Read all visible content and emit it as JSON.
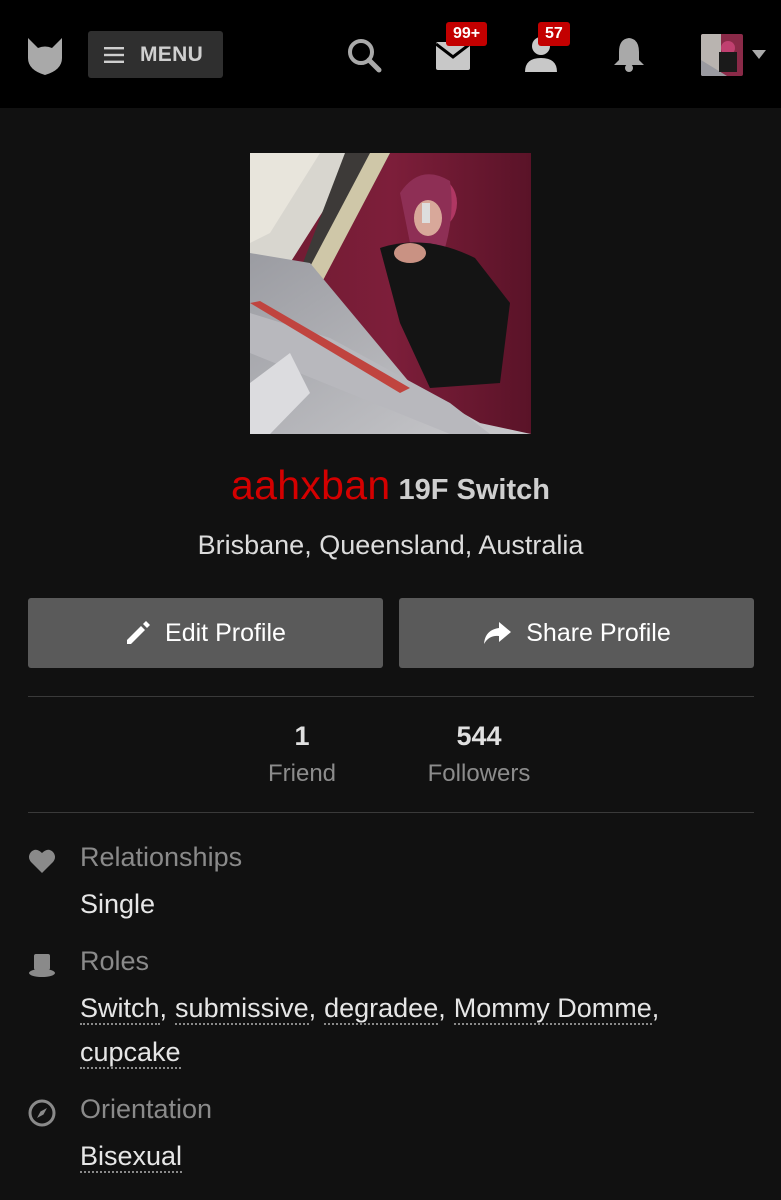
{
  "header": {
    "menu_label": "MENU",
    "mail_badge": "99+",
    "user_badge": "57",
    "icons": [
      "site-logo-icon",
      "search-icon",
      "mail-icon",
      "user-icon",
      "bell-icon",
      "chevron-down-icon"
    ]
  },
  "profile": {
    "username": "aahxban",
    "age_sex_role": "19F Switch",
    "location": "Brisbane, Queensland, Australia",
    "edit_label": "Edit Profile",
    "share_label": "Share Profile"
  },
  "stats": {
    "friends_count": "1",
    "friends_label": "Friend",
    "followers_count": "544",
    "followers_label": "Followers"
  },
  "details": {
    "relationships_title": "Relationships",
    "relationships_value": "Single",
    "roles_title": "Roles",
    "roles": [
      "Switch",
      "submissive",
      "degradee",
      "Mommy Domme",
      "cupcake"
    ],
    "orientation_title": "Orientation",
    "orientation_value": "Bisexual"
  },
  "colors": {
    "accent_red": "#d40000",
    "badge_red": "#c30000",
    "background": "#111111",
    "topbar": "#000000",
    "button": "#5a5a5a"
  }
}
